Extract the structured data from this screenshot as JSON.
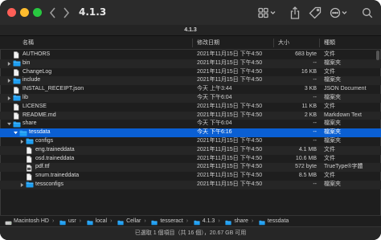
{
  "window": {
    "title": "4.1.3",
    "tab_title": "4.1.3"
  },
  "columns": {
    "name": "名稱",
    "date": "修改日期",
    "size": "大小",
    "kind": "種類"
  },
  "colors": {
    "folder": "#1e9ff2",
    "selection": "#0a5fd3",
    "close": "#fe5f57",
    "minimize": "#febc2e",
    "maximize": "#28c840"
  },
  "rows": [
    {
      "name": "AUTHORS",
      "date": "2021年11月15日 下午4:50",
      "size": "683 byte",
      "kind": "文件",
      "icon": "document-icon",
      "folder": false,
      "expanded": false,
      "depth": 0
    },
    {
      "name": "bin",
      "date": "2021年11月15日 下午4:50",
      "size": "--",
      "kind": "檔案夾",
      "icon": "folder-icon",
      "folder": true,
      "expanded": false,
      "depth": 0
    },
    {
      "name": "ChangeLog",
      "date": "2021年11月15日 下午4:50",
      "size": "16 KB",
      "kind": "文件",
      "icon": "document-icon",
      "folder": false,
      "expanded": false,
      "depth": 0
    },
    {
      "name": "include",
      "date": "2021年11月15日 下午4:50",
      "size": "--",
      "kind": "檔案夾",
      "icon": "folder-icon",
      "folder": true,
      "expanded": false,
      "depth": 0
    },
    {
      "name": "INSTALL_RECEIPT.json",
      "date": "今天 上午3:44",
      "size": "3 KB",
      "kind": "JSON Document",
      "icon": "document-icon",
      "folder": false,
      "expanded": false,
      "depth": 0
    },
    {
      "name": "lib",
      "date": "今天 下午6:04",
      "size": "--",
      "kind": "檔案夾",
      "icon": "folder-icon",
      "folder": true,
      "expanded": false,
      "depth": 0
    },
    {
      "name": "LICENSE",
      "date": "2021年11月15日 下午4:50",
      "size": "11 KB",
      "kind": "文件",
      "icon": "document-icon",
      "folder": false,
      "expanded": false,
      "depth": 0
    },
    {
      "name": "README.md",
      "date": "2021年11月15日 下午4:50",
      "size": "2 KB",
      "kind": "Markdown Text",
      "icon": "document-icon",
      "folder": false,
      "expanded": false,
      "depth": 0
    },
    {
      "name": "share",
      "date": "今天 下午6:04",
      "size": "--",
      "kind": "檔案夾",
      "icon": "folder-icon",
      "folder": true,
      "expanded": true,
      "depth": 0
    },
    {
      "name": "tessdata",
      "date": "今天 下午6:16",
      "size": "--",
      "kind": "檔案夾",
      "icon": "folder-icon",
      "folder": true,
      "expanded": true,
      "depth": 1,
      "selected": true
    },
    {
      "name": "configs",
      "date": "2021年11月15日 下午4:50",
      "size": "--",
      "kind": "檔案夾",
      "icon": "folder-icon",
      "folder": true,
      "expanded": false,
      "depth": 2
    },
    {
      "name": "eng.traineddata",
      "date": "2021年11月15日 下午4:50",
      "size": "4.1 MB",
      "kind": "文件",
      "icon": "document-icon",
      "folder": false,
      "expanded": false,
      "depth": 2
    },
    {
      "name": "osd.traineddata",
      "date": "2021年11月15日 下午4:50",
      "size": "10.6 MB",
      "kind": "文件",
      "icon": "document-icon",
      "folder": false,
      "expanded": false,
      "depth": 2
    },
    {
      "name": "pdf.ttf",
      "date": "2021年11月15日 下午4:50",
      "size": "572 byte",
      "kind": "TrueType®字體",
      "icon": "font-file-icon",
      "folder": false,
      "expanded": false,
      "depth": 2
    },
    {
      "name": "snum.traineddata",
      "date": "2021年11月15日 下午4:50",
      "size": "8.5 MB",
      "kind": "文件",
      "icon": "document-icon",
      "folder": false,
      "expanded": false,
      "depth": 2
    },
    {
      "name": "tessconfigs",
      "date": "2021年11月15日 下午4:50",
      "size": "--",
      "kind": "檔案夾",
      "icon": "folder-icon",
      "folder": true,
      "expanded": false,
      "depth": 2
    }
  ],
  "pathbar": [
    {
      "label": "Macintosh HD",
      "icon": "disk-icon"
    },
    {
      "label": "usr",
      "icon": "folder-icon"
    },
    {
      "label": "local",
      "icon": "folder-icon"
    },
    {
      "label": "Cellar",
      "icon": "folder-icon"
    },
    {
      "label": "tesseract",
      "icon": "folder-icon"
    },
    {
      "label": "4.1.3",
      "icon": "folder-icon"
    },
    {
      "label": "share",
      "icon": "folder-icon"
    },
    {
      "label": "tessdata",
      "icon": "folder-icon"
    }
  ],
  "status": "已選取 1 個項目（共 16 個），20.67 GB 可用"
}
